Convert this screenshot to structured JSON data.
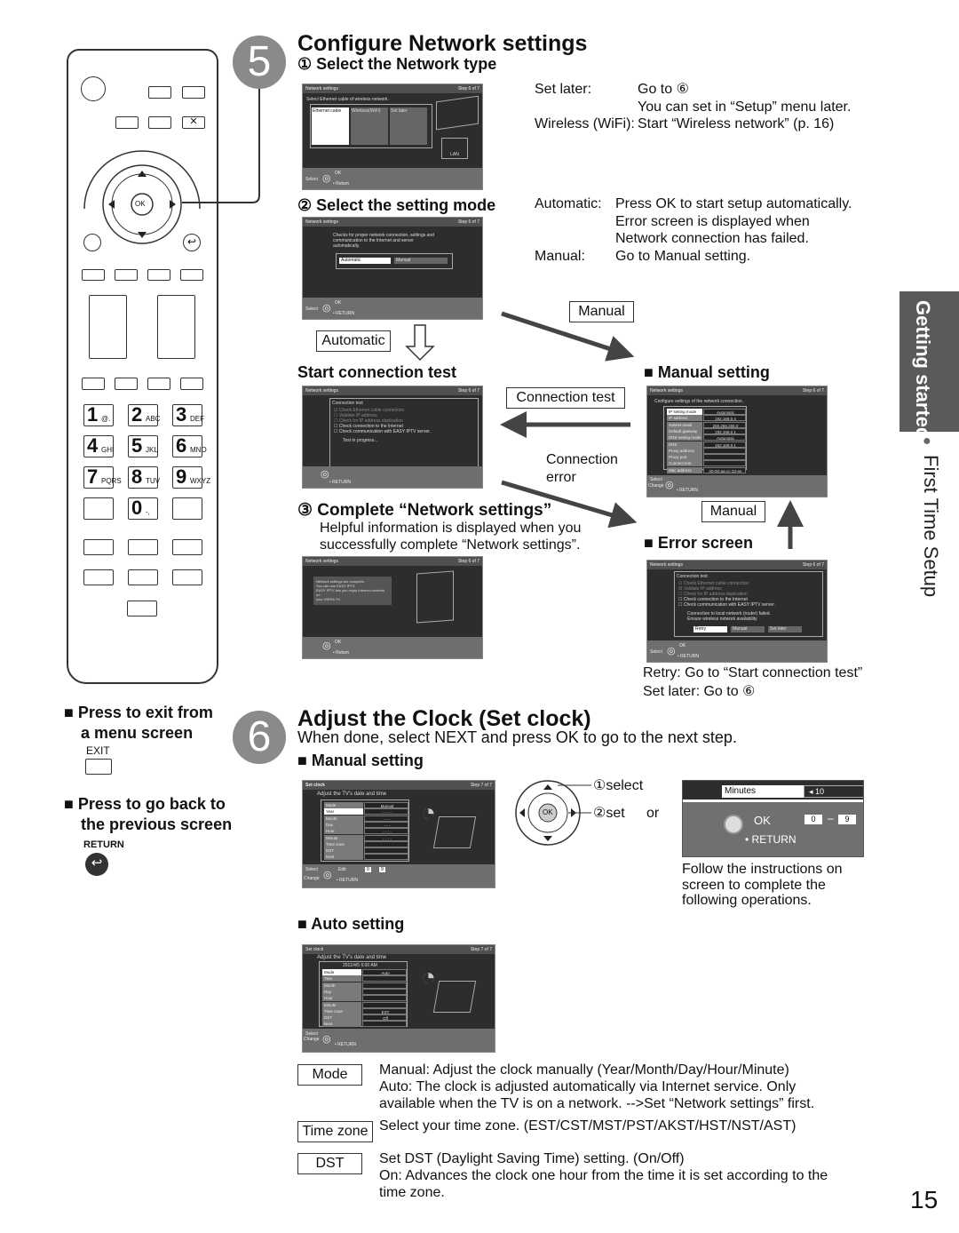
{
  "remote": {
    "keypad": [
      {
        "n": "1",
        "s": "@."
      },
      {
        "n": "2",
        "s": "ABC"
      },
      {
        "n": "3",
        "s": "DEF"
      },
      {
        "n": "4",
        "s": "GHI"
      },
      {
        "n": "5",
        "s": "JKL"
      },
      {
        "n": "6",
        "s": "MNO"
      },
      {
        "n": "7",
        "s": "PQRS"
      },
      {
        "n": "8",
        "s": "TUV"
      },
      {
        "n": "9",
        "s": "WXYZ"
      },
      {
        "n": "0",
        "s": "-,"
      }
    ],
    "ok": "OK"
  },
  "left": {
    "exit_title1": "■ Press to exit from",
    "exit_title2": "a menu screen",
    "exit_label": "EXIT",
    "back_title1": "■ Press to go back to",
    "back_title2": "the previous screen",
    "return_label": "RETURN"
  },
  "step5": {
    "number": "5",
    "title": "Configure Network settings",
    "sub1": "① Select the Network type",
    "screen1": {
      "title": "Network settings",
      "step": "Step 6 of 7",
      "prompt": "Select Ethernet cable of wireless network.",
      "options": [
        "Ethernet cable",
        "Wireless(WiFi)",
        "Set later"
      ],
      "lan": "LAN",
      "select": "Select",
      "ok": "OK",
      "return": "• Return"
    },
    "notes1": {
      "setlater_label": "Set later:",
      "setlater_text": "Go to ⑥",
      "setlater_text2": "You can set in “Setup” menu later.",
      "wifi_label": "Wireless (WiFi):",
      "wifi_text": "Start “Wireless network” (p. 16)"
    },
    "sub2": "② Select the setting mode",
    "screen2": {
      "title": "Network settings",
      "step": "Step 6 of 7",
      "desc1": "Checks for proper network connection, settings and",
      "desc2": "communication to the Internet and server",
      "desc3": "automatically.",
      "options": [
        "Automatic",
        "Manual"
      ],
      "select": "Select",
      "ok": "OK",
      "return": "• RETURN"
    },
    "notes2": {
      "auto_label": "Automatic:",
      "auto_lines": [
        "Press OK to start setup automatically.",
        "Error screen is displayed when",
        "Network connection has failed."
      ],
      "manual_label": "Manual:",
      "manual_text": "Go to Manual setting."
    },
    "manual_box": "Manual",
    "automatic_box": "Automatic",
    "start_test": "Start connection test",
    "screen3": {
      "title": "Network settings",
      "step": "Step 6 of 7",
      "heading": "Connection test",
      "items": [
        "Check Ethernet cable connection",
        "Validate IP address",
        "Check for IP address duplication",
        "Check connection to the Internet",
        "Check communication with EASY IPTV server."
      ],
      "progress": "Test in progress...",
      "return": "• RETURN"
    },
    "connection_test_box": "Connection test",
    "connection_error1": "Connection",
    "connection_error2": "error",
    "manual_setting": "■ Manual setting",
    "screen4": {
      "title": "Network settings",
      "step": "Step 6 of 7",
      "desc": "Configure settings of the network connection.",
      "rows": [
        {
          "l": "IP setting mode",
          "v": "Automatic"
        },
        {
          "l": "IP address",
          "v": "192.168.0.4"
        },
        {
          "l": "Subnet mask",
          "v": "255.255.255.0"
        },
        {
          "l": "Default gateway",
          "v": "192.168.0.1"
        },
        {
          "l": "DNS setting mode",
          "v": "Automatic"
        },
        {
          "l": "DNS",
          "v": "192.168.0.1"
        },
        {
          "l": "Proxy address",
          "v": ""
        },
        {
          "l": "Proxy port",
          "v": ""
        },
        {
          "l": "Connect test",
          "v": ""
        },
        {
          "l": "Mac address",
          "v": "00-00-aa-cc-33-ee"
        }
      ],
      "select": "Select",
      "change": "Change",
      "return": "• RETURN"
    },
    "sub3": "③ Complete “Network settings”",
    "sub3_text1": "Helpful information is displayed when you",
    "sub3_text2": "successfully complete “Network settings”.",
    "screen5": {
      "title": "Network settings",
      "step": "Step 6 of 7",
      "msg": [
        "Network settings are complete.",
        "You can use EASY IPTV.",
        "EASY IPTV lets you enjoy Internet contents on",
        "your VIERA TV."
      ],
      "ok": "OK",
      "return": "• Return"
    },
    "manual_box2": "Manual",
    "error_screen": "■ Error screen",
    "screen6": {
      "title": "Network settings",
      "step": "Step 6 of 7",
      "heading": "Connection test",
      "items": [
        "Check Ethernet cable connection",
        "Validate IP address",
        "Check for IP address duplication",
        "Check connection to the Internet",
        "Check communication with EASY IPTV server."
      ],
      "fail1": "Connection to local network (router) failed.",
      "fail2": "Ensure wireless network availability",
      "buttons": [
        "Retry",
        "Manual",
        "Set later"
      ],
      "select": "Select",
      "ok": "OK",
      "return": "• RETURN"
    },
    "retry_note": "Retry: Go to “Start connection test”",
    "setlater_note": "Set later: Go to ⑥"
  },
  "step6": {
    "number": "6",
    "title": "Adjust the Clock (Set clock)",
    "subtitle": "When done, select NEXT and press OK to go to the next step.",
    "manual_setting": "■ Manual setting",
    "screen7": {
      "title": "Set clock",
      "step": "Step 7 of 7",
      "desc": "Adjust the TV's date and time",
      "rows": [
        {
          "l": "Mode",
          "v": "Manual"
        },
        {
          "l": "Year",
          "v": "- - - -"
        },
        {
          "l": "Month",
          "v": "- - -"
        },
        {
          "l": "Day",
          "v": "- - -"
        },
        {
          "l": "Hour",
          "v": "- - : -"
        },
        {
          "l": "Minute",
          "v": "- - - -"
        },
        {
          "l": "Time zone",
          "v": ""
        },
        {
          "l": "DST",
          "v": ""
        },
        {
          "l": "Next",
          "v": ""
        }
      ],
      "select": "Select",
      "change": "Change",
      "edit": "Edit",
      "range_from": "0",
      "range_to": "9",
      "return": "• RETURN"
    },
    "dpad": {
      "select": "①select",
      "set": "②set",
      "or": "or",
      "ok": "OK"
    },
    "zoom": {
      "field": "Minutes",
      "value": "10",
      "ok": "OK",
      "from": "0",
      "dash": "–",
      "to": "9",
      "return": "• RETURN"
    },
    "follow": [
      "Follow the instructions on",
      "screen to complete the",
      "following operations."
    ],
    "auto_setting": "■ Auto setting",
    "screen8": {
      "title": "Set clock",
      "step": "Step 7 of 7",
      "desc": "Adjust the TV's date and time",
      "datetime": "2011/4/5  6:00 AM",
      "rows": [
        {
          "l": "Mode",
          "v": "Auto"
        },
        {
          "l": "Year",
          "v": ""
        },
        {
          "l": "Month",
          "v": ""
        },
        {
          "l": "Day",
          "v": ""
        },
        {
          "l": "Hour",
          "v": ""
        },
        {
          "l": "Minute",
          "v": ""
        },
        {
          "l": "Time zone",
          "v": "EST"
        },
        {
          "l": "DST",
          "v": "Off"
        },
        {
          "l": "Next",
          "v": ""
        }
      ],
      "select": "Select",
      "change": "Change",
      "return": "• RETURN"
    },
    "defs": [
      {
        "term": "Mode",
        "lines": [
          "Manual: Adjust the clock manually (Year/Month/Day/Hour/Minute)",
          "Auto: The clock is adjusted automatically via Internet service. Only",
          "available when the TV is on a network. -->Set “Network settings” first."
        ]
      },
      {
        "term": "Time zone",
        "lines": [
          "Select your time zone. (EST/CST/MST/PST/AKST/HST/NST/AST)"
        ]
      },
      {
        "term": "DST",
        "lines": [
          "Set DST (Daylight Saving Time) setting. (On/Off)",
          "On: Advances the clock one hour from the time it is set according to the",
          "time zone."
        ]
      }
    ]
  },
  "side": {
    "tab": "Getting started",
    "section": "First Time Setup",
    "bullet": "●"
  },
  "page_number": "15",
  "colors": {
    "tab_bg": "#5a5a5a",
    "screen_bg": "#2d2d2d",
    "step_circle": "#8a8a8a"
  }
}
